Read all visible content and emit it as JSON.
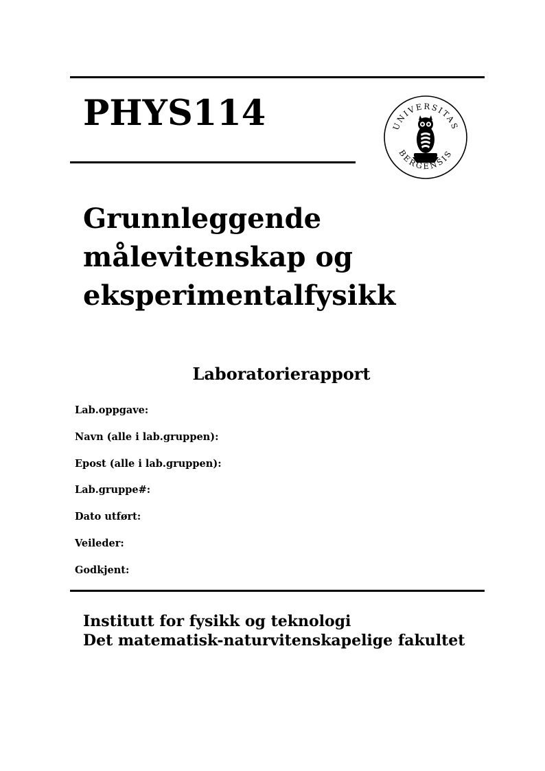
{
  "header": {
    "course_code": "PHYS114",
    "logo_text_top": "UNIVERSITAS",
    "logo_text_bottom": "BERGENSIS"
  },
  "title": {
    "lines": [
      "Grunnleggende",
      "målevitenskap og",
      "eksperimentalfysikk"
    ]
  },
  "report": {
    "heading": "Laboratorierapport",
    "fields": [
      "Lab.oppgave:",
      "Navn (alle i lab.gruppen):",
      "Epost (alle i lab.gruppen):",
      "Lab.gruppe#:",
      "Dato utført:",
      "Veileder:",
      "Godkjent:"
    ]
  },
  "footer": {
    "institute": "Institutt for fysikk og teknologi",
    "faculty": "Det matematisk-naturvitenskapelige fakultet"
  }
}
